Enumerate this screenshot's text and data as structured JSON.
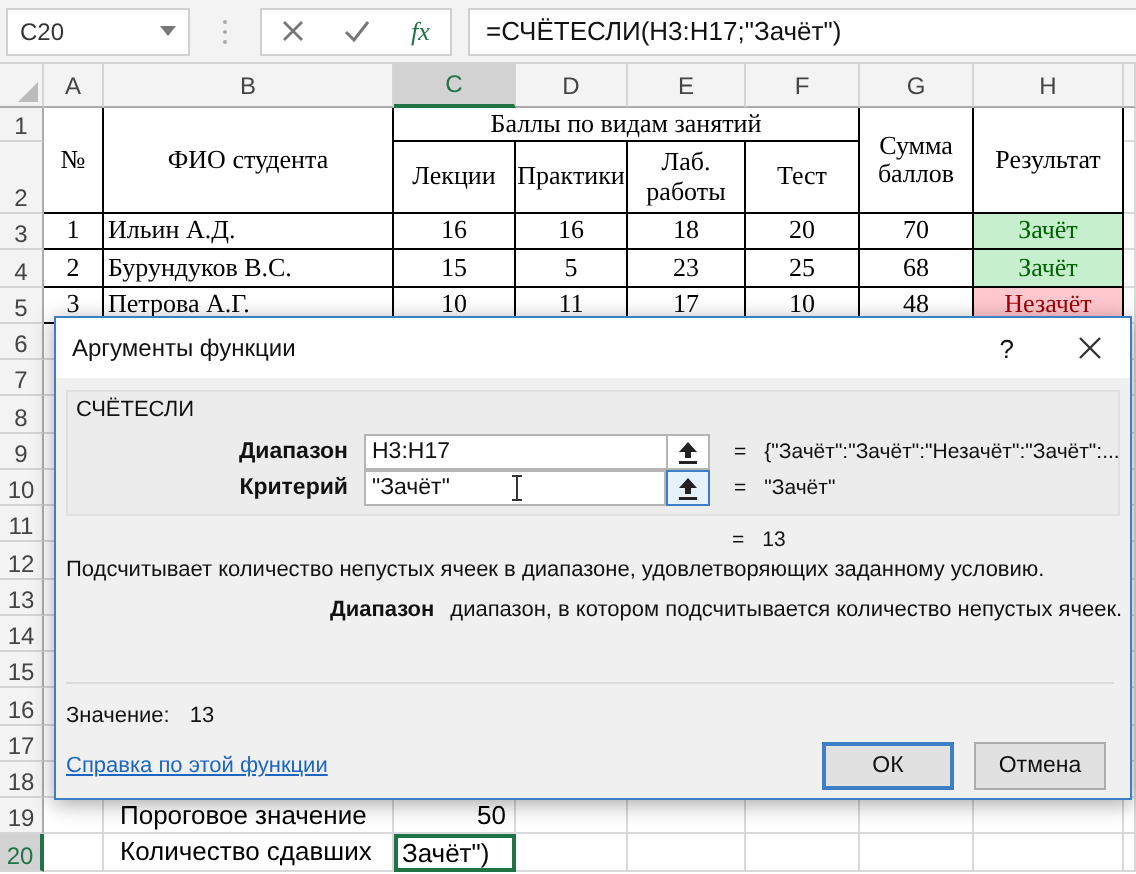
{
  "formula_bar": {
    "name_box": "C20",
    "function_button": "fx",
    "formula": "=СЧЁТЕСЛИ(H3:H17;\"Зачёт\")"
  },
  "columns": [
    {
      "label": "A",
      "selected": false
    },
    {
      "label": "B",
      "selected": false
    },
    {
      "label": "C",
      "selected": true
    },
    {
      "label": "D",
      "selected": false
    },
    {
      "label": "E",
      "selected": false
    },
    {
      "label": "F",
      "selected": false
    },
    {
      "label": "G",
      "selected": false
    },
    {
      "label": "H",
      "selected": false
    }
  ],
  "row_numbers": [
    {
      "label": "1",
      "selected": false
    },
    {
      "label": "2",
      "selected": false
    },
    {
      "label": "3",
      "selected": false
    },
    {
      "label": "4",
      "selected": false
    },
    {
      "label": "5",
      "selected": false
    },
    {
      "label": "6",
      "selected": false
    },
    {
      "label": "7",
      "selected": false
    },
    {
      "label": "8",
      "selected": false
    },
    {
      "label": "9",
      "selected": false
    },
    {
      "label": "10",
      "selected": false
    },
    {
      "label": "11",
      "selected": false
    },
    {
      "label": "12",
      "selected": false
    },
    {
      "label": "13",
      "selected": false
    },
    {
      "label": "14",
      "selected": false
    },
    {
      "label": "15",
      "selected": false
    },
    {
      "label": "16",
      "selected": false
    },
    {
      "label": "17",
      "selected": false
    },
    {
      "label": "18",
      "selected": false
    },
    {
      "label": "19",
      "selected": false
    },
    {
      "label": "20",
      "selected": true
    }
  ],
  "table": {
    "number_heading": "№",
    "name_heading": "ФИО студента",
    "group_heading": "Баллы по видам занятий",
    "sub_headings": [
      "Лекции",
      "Практики",
      "Лаб. работы",
      "Тест"
    ],
    "sum_heading": "Сумма баллов",
    "result_heading": "Результат",
    "rows": [
      {
        "number": "1",
        "name": "Ильин А.Д.",
        "scores": [
          "16",
          "16",
          "18",
          "20"
        ],
        "sum": "70",
        "result": "Зачёт",
        "passed": true
      },
      {
        "number": "2",
        "name": "Бурундуков В.С.",
        "scores": [
          "15",
          "5",
          "23",
          "25"
        ],
        "sum": "68",
        "result": "Зачёт",
        "passed": true
      },
      {
        "number": "3",
        "name": "Петрова А.Г.",
        "scores": [
          "10",
          "11",
          "17",
          "10"
        ],
        "sum": "48",
        "result": "Незачёт",
        "passed": false
      }
    ]
  },
  "summary": [
    {
      "label": "Пороговое значение",
      "value": "50",
      "selected": false
    },
    {
      "label": "Количество сдавших",
      "value": "Зачёт\")",
      "selected": true
    }
  ],
  "dialog": {
    "title": "Аргументы функции",
    "help": "?",
    "function_name": "СЧЁТЕСЛИ",
    "arguments": [
      {
        "label": "Диапазон",
        "value": "H3:H17",
        "equals": "=",
        "result": "{\"Зачёт\":\"Зачёт\":\"Незачёт\":\"Зачёт\":...",
        "focused": false
      },
      {
        "label": "Критерий",
        "value": "\"Зачёт\"",
        "equals": "=",
        "result": "\"Зачёт\"",
        "focused": true
      }
    ],
    "result_equals": "=",
    "result": "13",
    "description": "Подсчитывает количество непустых ячеек в диапазоне, удовлетворяющих заданному условию.",
    "argument_help": {
      "name": "Диапазон",
      "text": "диапазон, в котором подсчитывается количество непустых ячеек."
    },
    "value_label": "Значение:",
    "value": "13",
    "help_link": "Справка по этой функции",
    "ok": "ОК",
    "cancel": "Отмена"
  }
}
